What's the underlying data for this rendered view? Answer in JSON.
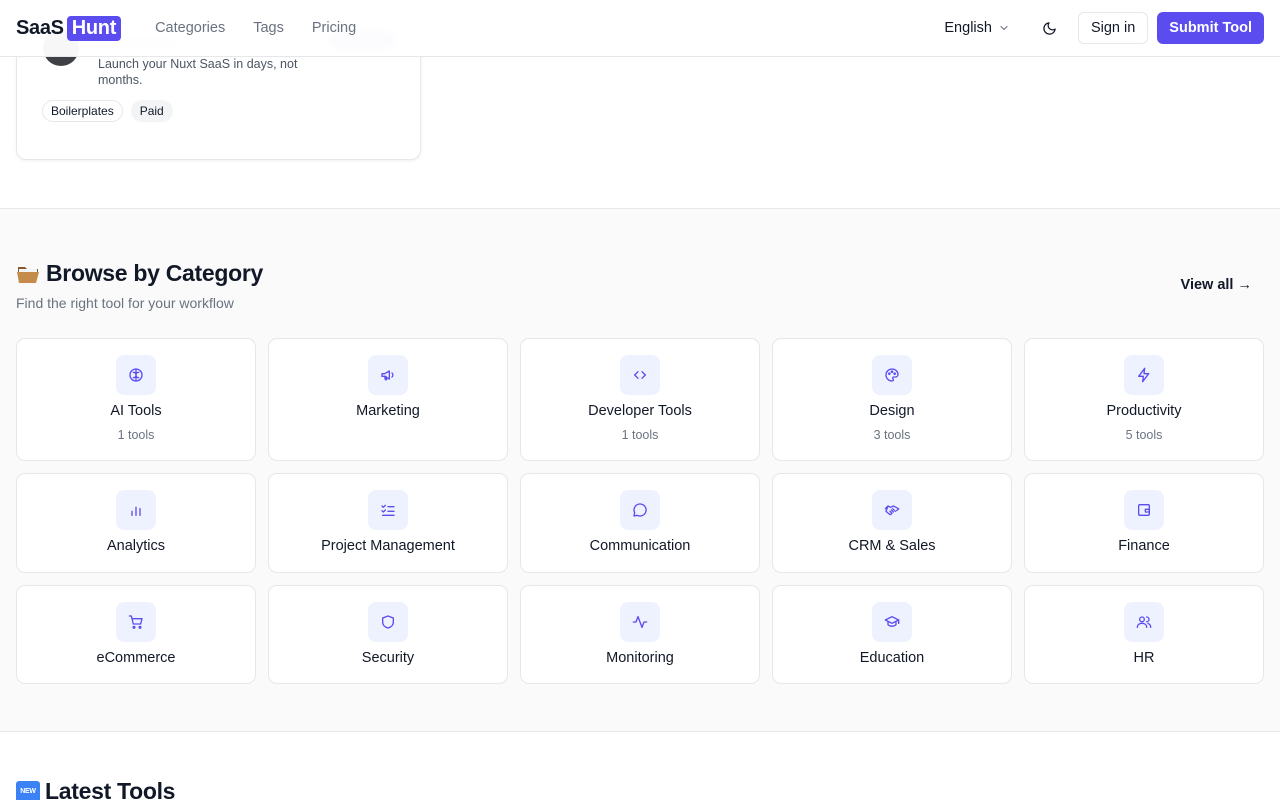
{
  "header": {
    "logo_part1": "SaaS",
    "logo_part2": "Hunt",
    "nav": [
      "Categories",
      "Tags",
      "Pricing"
    ],
    "language": "English",
    "sign_in": "Sign in",
    "submit": "Submit Tool"
  },
  "tool_card": {
    "description": "Launch your Nuxt SaaS in days, not months.",
    "tags": [
      "Boilerplates",
      "Paid"
    ]
  },
  "browse": {
    "title": "Browse by Category",
    "subtitle": "Find the right tool for your workflow",
    "view_all": "View all →",
    "categories": [
      {
        "name": "AI Tools",
        "count": "1 tools",
        "icon": "brain-icon"
      },
      {
        "name": "Marketing",
        "count": "",
        "icon": "megaphone-icon"
      },
      {
        "name": "Developer Tools",
        "count": "1 tools",
        "icon": "code-icon"
      },
      {
        "name": "Design",
        "count": "3 tools",
        "icon": "palette-icon"
      },
      {
        "name": "Productivity",
        "count": "5 tools",
        "icon": "lightning-icon"
      },
      {
        "name": "Analytics",
        "count": "",
        "icon": "bar-chart-icon"
      },
      {
        "name": "Project Management",
        "count": "",
        "icon": "checklist-icon"
      },
      {
        "name": "Communication",
        "count": "",
        "icon": "chat-bubble-icon"
      },
      {
        "name": "CRM & Sales",
        "count": "",
        "icon": "handshake-icon"
      },
      {
        "name": "Finance",
        "count": "",
        "icon": "wallet-icon"
      },
      {
        "name": "eCommerce",
        "count": "",
        "icon": "cart-icon"
      },
      {
        "name": "Security",
        "count": "",
        "icon": "shield-icon"
      },
      {
        "name": "Monitoring",
        "count": "",
        "icon": "activity-icon"
      },
      {
        "name": "Education",
        "count": "",
        "icon": "graduation-cap-icon"
      },
      {
        "name": "HR",
        "count": "",
        "icon": "users-icon"
      }
    ]
  },
  "latest": {
    "badge": "NEW",
    "title": "Latest Tools"
  },
  "colors": {
    "accent": "#5b4cf0",
    "icon_bg": "#eef2ff",
    "icon_stroke": "#5b4cf0"
  }
}
